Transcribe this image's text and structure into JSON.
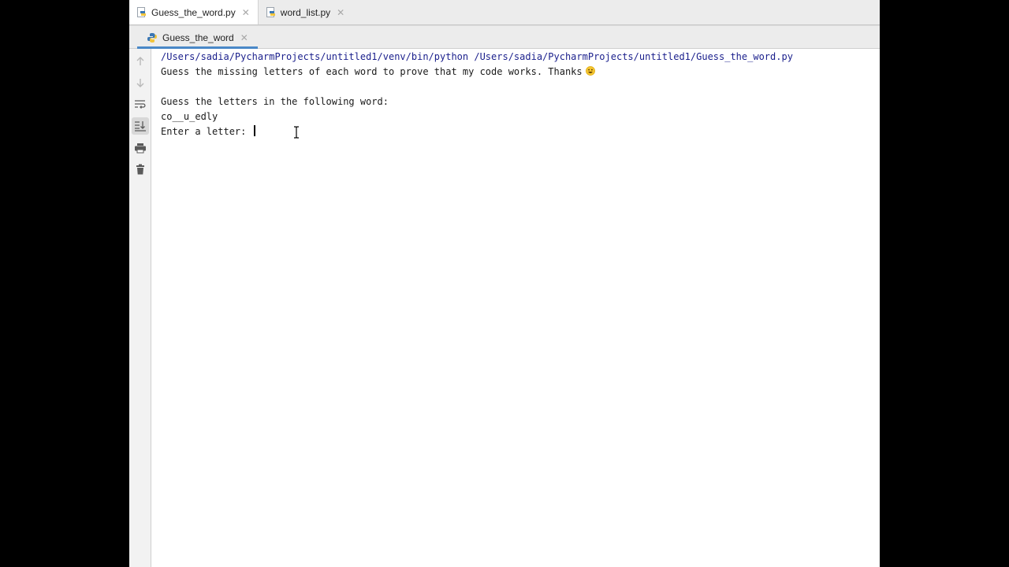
{
  "editor_tabs": [
    {
      "label": "Guess_the_word.py",
      "active": true
    },
    {
      "label": "word_list.py",
      "active": false
    }
  ],
  "tab_close_glyph": "✕",
  "run_tab": {
    "label": "Guess_the_word"
  },
  "toolbar": {
    "icons": [
      "up-arrow-icon",
      "down-arrow-icon",
      "soft-wrap-icon",
      "scroll-to-end-icon",
      "print-icon",
      "trash-icon"
    ]
  },
  "console": {
    "command": "/Users/sadia/PycharmProjects/untitled1/venv/bin/python /Users/sadia/PycharmProjects/untitled1/Guess_the_word.py",
    "intro": "Guess the missing letters of each word to prove that my code works. Thanks",
    "blank": "",
    "prompt_heading": "Guess the letters in the following word:",
    "masked_word": "co__u_edly",
    "input_prompt": "Enter a letter: "
  },
  "colors": {
    "accent": "#4a88c7",
    "command_text": "#1a1f8c",
    "python_blue": "#3a77b5",
    "python_yellow": "#f2c53d"
  }
}
